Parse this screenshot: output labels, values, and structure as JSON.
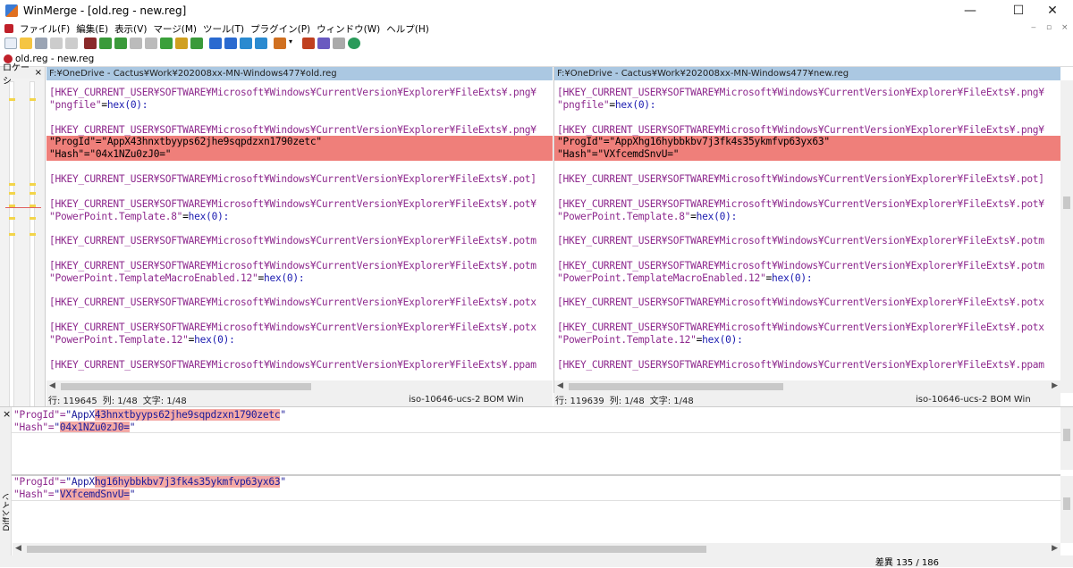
{
  "window": {
    "title": "WinMerge - [old.reg - new.reg]",
    "minimize": "—",
    "maximize": "☐",
    "close": "✕"
  },
  "menu": [
    "ファイル(F)",
    "編集(E)",
    "表示(V)",
    "マージ(M)",
    "ツール(T)",
    "プラグイン(P)",
    "ウィンドウ(W)",
    "ヘルプ(H)"
  ],
  "mdi": {
    "min": "‒",
    "restore": "▫",
    "close": "×"
  },
  "tab": {
    "label": "old.reg - new.reg"
  },
  "location_pane": {
    "title": "ロケーシ",
    "close": "×"
  },
  "left": {
    "path": "F:¥OneDrive - Cactus¥Work¥202008xx-MN-Windows477¥old.reg",
    "status": {
      "line": "行: 119645",
      "col": "列: 1/48",
      "char": "文字: 1/48",
      "encoding": "iso-10646-ucs-2 BOM  Win"
    },
    "lines": [
      {
        "k": "[HKEY_CURRENT_USER¥SOFTWARE¥Microsoft¥Windows¥CurrentVersion¥Explorer¥FileExts¥.png¥",
        "t": "key"
      },
      {
        "k": "\"pngfile\"=hex(0):",
        "t": "val"
      },
      {
        "k": "",
        "t": "empty"
      },
      {
        "k": "[HKEY_CURRENT_USER¥SOFTWARE¥Microsoft¥Windows¥CurrentVersion¥Explorer¥FileExts¥.png¥",
        "t": "key"
      },
      {
        "k": "\"ProgId\"=\"AppX43hnxtbyyps62jhe9sqpdzxn1790zetc\"",
        "t": "diff"
      },
      {
        "k": "\"Hash\"=\"04x1NZu0zJ0=\"",
        "t": "diff"
      },
      {
        "k": "",
        "t": "empty"
      },
      {
        "k": "[HKEY_CURRENT_USER¥SOFTWARE¥Microsoft¥Windows¥CurrentVersion¥Explorer¥FileExts¥.pot]",
        "t": "key"
      },
      {
        "k": "",
        "t": "empty"
      },
      {
        "k": "[HKEY_CURRENT_USER¥SOFTWARE¥Microsoft¥Windows¥CurrentVersion¥Explorer¥FileExts¥.pot¥",
        "t": "key"
      },
      {
        "k": "\"PowerPoint.Template.8\"=hex(0):",
        "t": "val"
      },
      {
        "k": "",
        "t": "empty"
      },
      {
        "k": "[HKEY_CURRENT_USER¥SOFTWARE¥Microsoft¥Windows¥CurrentVersion¥Explorer¥FileExts¥.potm",
        "t": "key"
      },
      {
        "k": "",
        "t": "empty"
      },
      {
        "k": "[HKEY_CURRENT_USER¥SOFTWARE¥Microsoft¥Windows¥CurrentVersion¥Explorer¥FileExts¥.potm",
        "t": "key"
      },
      {
        "k": "\"PowerPoint.TemplateMacroEnabled.12\"=hex(0):",
        "t": "val"
      },
      {
        "k": "",
        "t": "empty"
      },
      {
        "k": "[HKEY_CURRENT_USER¥SOFTWARE¥Microsoft¥Windows¥CurrentVersion¥Explorer¥FileExts¥.potx",
        "t": "key"
      },
      {
        "k": "",
        "t": "empty"
      },
      {
        "k": "[HKEY_CURRENT_USER¥SOFTWARE¥Microsoft¥Windows¥CurrentVersion¥Explorer¥FileExts¥.potx",
        "t": "key"
      },
      {
        "k": "\"PowerPoint.Template.12\"=hex(0):",
        "t": "val"
      },
      {
        "k": "",
        "t": "empty"
      },
      {
        "k": "[HKEY_CURRENT_USER¥SOFTWARE¥Microsoft¥Windows¥CurrentVersion¥Explorer¥FileExts¥.ppam",
        "t": "key"
      }
    ]
  },
  "right": {
    "path": "F:¥OneDrive - Cactus¥Work¥202008xx-MN-Windows477¥new.reg",
    "status": {
      "line": "行: 119639",
      "col": "列: 1/48",
      "char": "文字: 1/48",
      "encoding": "iso-10646-ucs-2 BOM  Win"
    },
    "lines": [
      {
        "k": "[HKEY_CURRENT_USER¥SOFTWARE¥Microsoft¥Windows¥CurrentVersion¥Explorer¥FileExts¥.png¥",
        "t": "key"
      },
      {
        "k": "\"pngfile\"=hex(0):",
        "t": "val"
      },
      {
        "k": "",
        "t": "empty"
      },
      {
        "k": "[HKEY_CURRENT_USER¥SOFTWARE¥Microsoft¥Windows¥CurrentVersion¥Explorer¥FileExts¥.png¥",
        "t": "key"
      },
      {
        "k": "\"ProgId\"=\"AppXhg16hybbkbv7j3fk4s35ykmfvp63yx63\"",
        "t": "diff"
      },
      {
        "k": "\"Hash\"=\"VXfcemdSnvU=\"",
        "t": "diff"
      },
      {
        "k": "",
        "t": "empty"
      },
      {
        "k": "[HKEY_CURRENT_USER¥SOFTWARE¥Microsoft¥Windows¥CurrentVersion¥Explorer¥FileExts¥.pot]",
        "t": "key"
      },
      {
        "k": "",
        "t": "empty"
      },
      {
        "k": "[HKEY_CURRENT_USER¥SOFTWARE¥Microsoft¥Windows¥CurrentVersion¥Explorer¥FileExts¥.pot¥",
        "t": "key"
      },
      {
        "k": "\"PowerPoint.Template.8\"=hex(0):",
        "t": "val"
      },
      {
        "k": "",
        "t": "empty"
      },
      {
        "k": "[HKEY_CURRENT_USER¥SOFTWARE¥Microsoft¥Windows¥CurrentVersion¥Explorer¥FileExts¥.potm",
        "t": "key"
      },
      {
        "k": "",
        "t": "empty"
      },
      {
        "k": "[HKEY_CURRENT_USER¥SOFTWARE¥Microsoft¥Windows¥CurrentVersion¥Explorer¥FileExts¥.potm",
        "t": "key"
      },
      {
        "k": "\"PowerPoint.TemplateMacroEnabled.12\"=hex(0):",
        "t": "val"
      },
      {
        "k": "",
        "t": "empty"
      },
      {
        "k": "[HKEY_CURRENT_USER¥SOFTWARE¥Microsoft¥Windows¥CurrentVersion¥Explorer¥FileExts¥.potx",
        "t": "key"
      },
      {
        "k": "",
        "t": "empty"
      },
      {
        "k": "[HKEY_CURRENT_USER¥SOFTWARE¥Microsoft¥Windows¥CurrentVersion¥Explorer¥FileExts¥.potx",
        "t": "key"
      },
      {
        "k": "\"PowerPoint.Template.12\"=hex(0):",
        "t": "val"
      },
      {
        "k": "",
        "t": "empty"
      },
      {
        "k": "[HKEY_CURRENT_USER¥SOFTWARE¥Microsoft¥Windows¥CurrentVersion¥Explorer¥FileExts¥.ppam",
        "t": "key"
      }
    ]
  },
  "diff_pane": {
    "label": "Diffペイン",
    "left_progid": "\"ProgId\"=\"AppX43hnxtbyyps62jhe9sqpdzxn1790zetc\"",
    "left_hash": "\"Hash\"=\"04x1NZu0zJ0=\"",
    "right_progid": "\"ProgId\"=\"AppXhg16hybbkbv7j3fk4s35ykmfvp63yx63\"",
    "right_hash": "\"Hash\"=\"VXfcemdSnvU=\""
  },
  "statusbar": {
    "diff_count": "差異 135 / 186"
  },
  "colors": {
    "diff_bg": "#ef7f7a",
    "path_header": "#abc8e2",
    "key_text": "#8e2a8e",
    "string_text": "#1a1a9a"
  }
}
